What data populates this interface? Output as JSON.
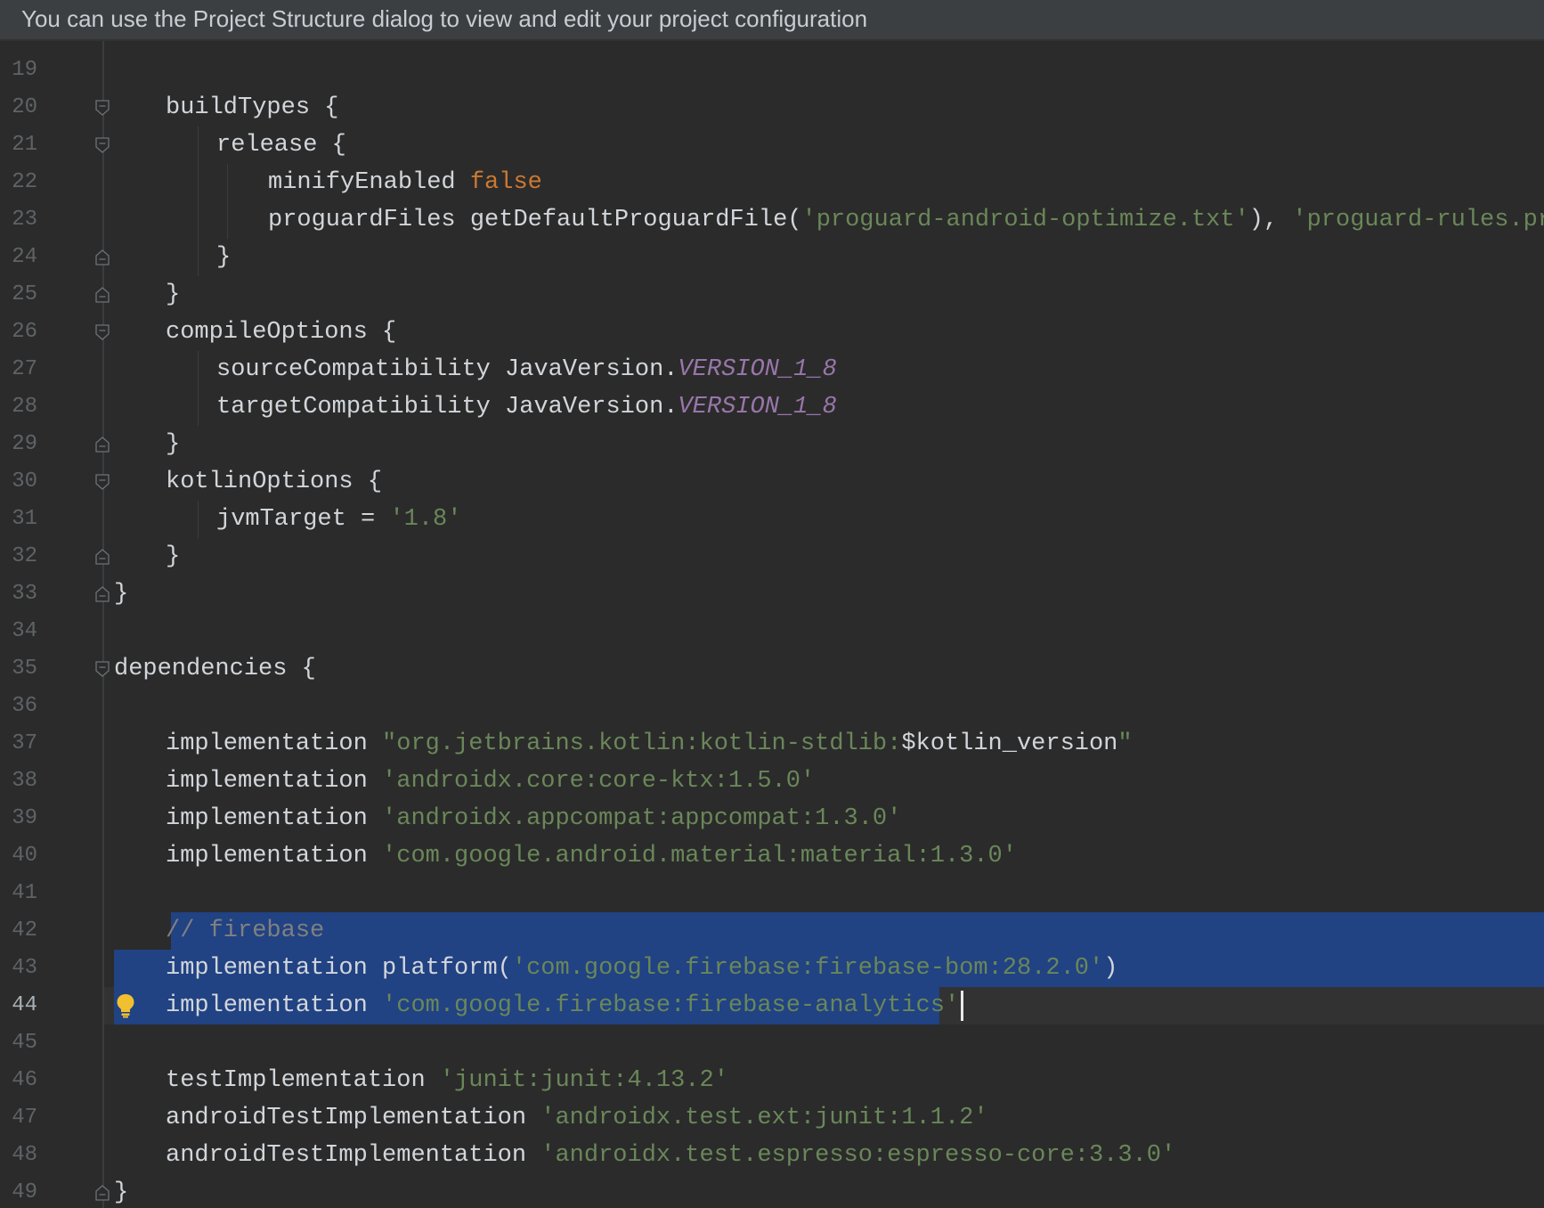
{
  "banner": {
    "text": "You can use the Project Structure dialog to view and edit your project configuration"
  },
  "editor": {
    "current_line": 44,
    "lines": [
      {
        "n": "19",
        "tokens": []
      },
      {
        "n": "20",
        "tokens": [
          {
            "t": "buildTypes {",
            "c": ""
          }
        ]
      },
      {
        "n": "21",
        "tokens": [
          {
            "t": "release {",
            "c": ""
          }
        ]
      },
      {
        "n": "22",
        "tokens": [
          {
            "t": "minifyEnabled ",
            "c": ""
          },
          {
            "t": "false",
            "c": "kw-orange"
          }
        ]
      },
      {
        "n": "23",
        "tokens": [
          {
            "t": "proguardFiles getDefaultProguardFile(",
            "c": ""
          },
          {
            "t": "'proguard-android-optimize.txt'",
            "c": "str"
          },
          {
            "t": "), ",
            "c": ""
          },
          {
            "t": "'proguard-rules.pr",
            "c": "str"
          }
        ]
      },
      {
        "n": "24",
        "tokens": [
          {
            "t": "}",
            "c": ""
          }
        ]
      },
      {
        "n": "25",
        "tokens": [
          {
            "t": "}",
            "c": ""
          }
        ]
      },
      {
        "n": "26",
        "tokens": [
          {
            "t": "compileOptions {",
            "c": ""
          }
        ]
      },
      {
        "n": "27",
        "tokens": [
          {
            "t": "sourceCompatibility JavaVersion.",
            "c": ""
          },
          {
            "t": "VERSION_1_8",
            "c": "const"
          }
        ]
      },
      {
        "n": "28",
        "tokens": [
          {
            "t": "targetCompatibility JavaVersion.",
            "c": ""
          },
          {
            "t": "VERSION_1_8",
            "c": "const"
          }
        ]
      },
      {
        "n": "29",
        "tokens": [
          {
            "t": "}",
            "c": ""
          }
        ]
      },
      {
        "n": "30",
        "tokens": [
          {
            "t": "kotlinOptions {",
            "c": ""
          }
        ]
      },
      {
        "n": "31",
        "tokens": [
          {
            "t": "jvmTarget = ",
            "c": ""
          },
          {
            "t": "'1.8'",
            "c": "str"
          }
        ]
      },
      {
        "n": "32",
        "tokens": [
          {
            "t": "}",
            "c": ""
          }
        ]
      },
      {
        "n": "33",
        "tokens": [
          {
            "t": "}",
            "c": ""
          }
        ]
      },
      {
        "n": "34",
        "tokens": []
      },
      {
        "n": "35",
        "tokens": [
          {
            "t": "dependencies {",
            "c": ""
          }
        ]
      },
      {
        "n": "36",
        "tokens": []
      },
      {
        "n": "37",
        "tokens": [
          {
            "t": "implementation ",
            "c": ""
          },
          {
            "t": "\"org.jetbrains.kotlin:kotlin-stdlib:",
            "c": "str"
          },
          {
            "t": "$kotlin_version",
            "c": ""
          },
          {
            "t": "\"",
            "c": "str"
          }
        ]
      },
      {
        "n": "38",
        "tokens": [
          {
            "t": "implementation ",
            "c": ""
          },
          {
            "t": "'androidx.core:core-ktx:1.5.0'",
            "c": "str"
          }
        ]
      },
      {
        "n": "39",
        "tokens": [
          {
            "t": "implementation ",
            "c": ""
          },
          {
            "t": "'androidx.appcompat:appcompat:1.3.0'",
            "c": "str"
          }
        ]
      },
      {
        "n": "40",
        "tokens": [
          {
            "t": "implementation ",
            "c": ""
          },
          {
            "t": "'com.google.android.material:material:1.3.0'",
            "c": "str"
          }
        ]
      },
      {
        "n": "41",
        "tokens": []
      },
      {
        "n": "42",
        "tokens": [
          {
            "t": "// firebase",
            "c": "comment"
          }
        ]
      },
      {
        "n": "43",
        "tokens": [
          {
            "t": "implementation platform(",
            "c": ""
          },
          {
            "t": "'com.google.firebase:firebase-bom:28.2.0'",
            "c": "str"
          },
          {
            "t": ")",
            "c": ""
          }
        ]
      },
      {
        "n": "44",
        "tokens": [
          {
            "t": "implementation ",
            "c": ""
          },
          {
            "t": "'com.google.firebase:firebase-analytics'",
            "c": "str"
          }
        ]
      },
      {
        "n": "45",
        "tokens": []
      },
      {
        "n": "46",
        "tokens": [
          {
            "t": "testImplementation ",
            "c": ""
          },
          {
            "t": "'junit:junit:4.13.2'",
            "c": "str"
          }
        ]
      },
      {
        "n": "47",
        "tokens": [
          {
            "t": "androidTestImplementation ",
            "c": ""
          },
          {
            "t": "'androidx.test.ext:junit:1.1.2'",
            "c": "str"
          }
        ]
      },
      {
        "n": "48",
        "tokens": [
          {
            "t": "androidTestImplementation ",
            "c": ""
          },
          {
            "t": "'androidx.test.espresso:espresso-core:3.3.0'",
            "c": "str"
          }
        ]
      },
      {
        "n": "49",
        "tokens": [
          {
            "t": "}",
            "c": ""
          }
        ]
      }
    ]
  },
  "colors": {
    "background": "#2b2b2b",
    "selection": "#214283",
    "keyword": "#cc7832",
    "string": "#6a8759",
    "constant": "#9876aa",
    "comment": "#808080"
  }
}
